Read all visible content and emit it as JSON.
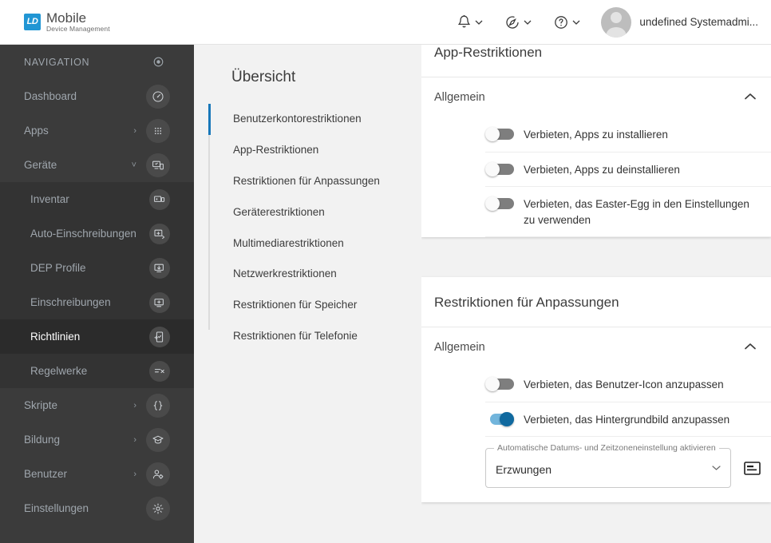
{
  "header": {
    "logo": {
      "mark": "LD",
      "title": "Mobile",
      "subtitle": "Device Management"
    },
    "notifications_icon": "bell-icon",
    "compass_icon": "compass-icon",
    "help_icon": "help-icon",
    "user_name": "undefined Systemadmi..."
  },
  "sidebar": {
    "section_label": "NAVIGATION",
    "section_icon": "target-icon",
    "items": [
      {
        "label": "Dashboard",
        "icon": "speedometer-icon",
        "name": "dashboard",
        "expandable": false,
        "active": false,
        "sub": false,
        "filled": true
      },
      {
        "label": "Apps",
        "icon": "grid-icon",
        "name": "apps",
        "expandable": true,
        "arrow": "›",
        "active": false,
        "sub": false,
        "filled": true
      },
      {
        "label": "Geräte",
        "icon": "devices-icon",
        "name": "geraete",
        "expandable": true,
        "arrow": "˅",
        "active": false,
        "sub": false,
        "filled": true
      },
      {
        "label": "Inventar",
        "icon": "inventory-icon",
        "name": "inventar",
        "expandable": false,
        "active": false,
        "sub": true,
        "filled": true
      },
      {
        "label": "Auto-Einschreibungen",
        "icon": "auto-enroll-icon",
        "name": "auto-einschreibungen",
        "expandable": false,
        "active": false,
        "sub": true,
        "filled": true
      },
      {
        "label": "DEP Profile",
        "icon": "dep-profile-icon",
        "name": "dep-profile",
        "expandable": false,
        "active": false,
        "sub": true,
        "filled": true
      },
      {
        "label": "Einschreibungen",
        "icon": "enroll-icon",
        "name": "einschreibungen",
        "expandable": false,
        "active": false,
        "sub": true,
        "filled": true
      },
      {
        "label": "Richtlinien",
        "icon": "policy-icon",
        "name": "richtlinien",
        "expandable": false,
        "active": true,
        "sub": true,
        "filled": true
      },
      {
        "label": "Regelwerke",
        "icon": "rules-icon",
        "name": "regelwerke",
        "expandable": false,
        "active": false,
        "sub": true,
        "filled": true
      },
      {
        "label": "Skripte",
        "icon": "braces-icon",
        "name": "skripte",
        "expandable": true,
        "arrow": "›",
        "active": false,
        "sub": false,
        "filled": true
      },
      {
        "label": "Bildung",
        "icon": "graduation-cap-icon",
        "name": "bildung",
        "expandable": true,
        "arrow": "›",
        "active": false,
        "sub": false,
        "filled": true
      },
      {
        "label": "Benutzer",
        "icon": "user-settings-icon",
        "name": "benutzer",
        "expandable": true,
        "arrow": "›",
        "active": false,
        "sub": false,
        "filled": true
      },
      {
        "label": "Einstellungen",
        "icon": "gear-icon",
        "name": "einstellungen",
        "expandable": false,
        "active": false,
        "sub": false,
        "filled": true
      }
    ]
  },
  "overview": {
    "title": "Übersicht",
    "items": [
      {
        "label": "Benutzerkontorestriktionen",
        "active": true
      },
      {
        "label": "App-Restriktionen",
        "active": false
      },
      {
        "label": "Restriktionen für Anpassungen",
        "active": false
      },
      {
        "label": "Geräterestriktionen",
        "active": false
      },
      {
        "label": "Multimediarestriktionen",
        "active": false
      },
      {
        "label": "Netzwerkrestriktionen",
        "active": false
      },
      {
        "label": "Restriktionen für Speicher",
        "active": false
      },
      {
        "label": "Restriktionen für Telefonie",
        "active": false
      }
    ]
  },
  "main": {
    "cards": [
      {
        "title": "App-Restriktionen",
        "section_label": "Allgemein",
        "collapse_icon": "chevron-up-icon",
        "rows": [
          {
            "label": "Verbieten, Apps zu installieren",
            "on": false
          },
          {
            "label": "Verbieten, Apps zu deinstallieren",
            "on": false
          },
          {
            "label": "Verbieten, das Easter-Egg in den Einstellungen zu verwenden",
            "on": false
          }
        ]
      },
      {
        "title": "Restriktionen für Anpassungen",
        "section_label": "Allgemein",
        "collapse_icon": "chevron-up-icon",
        "rows": [
          {
            "label": "Verbieten, das Benutzer-Icon anzupassen",
            "on": false
          },
          {
            "label": "Verbieten, das Hintergrundbild anzupassen",
            "on": true
          }
        ],
        "select": {
          "label": "Automatische Datums- und Zeitzoneneinstellung aktivieren",
          "value": "Erzwungen",
          "arrow_icon": "chevron-down-icon",
          "side_icon": "card-list-icon"
        }
      }
    ]
  },
  "colors": {
    "accent": "#1878b9",
    "toggle_on_track": "#72b5dc",
    "toggle_on_knob": "#10699f",
    "sidebar_bg": "#3b3b3b",
    "logo_blue": "#2196d4"
  }
}
